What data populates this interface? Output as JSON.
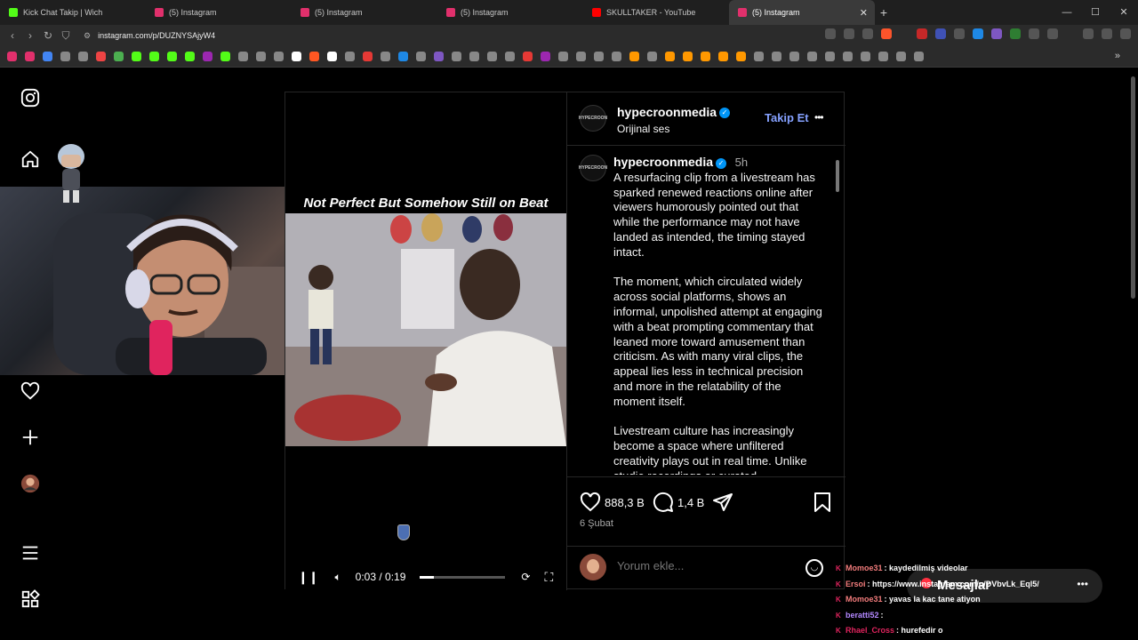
{
  "browser": {
    "tabs": [
      {
        "label": "Kick Chat Takip | Wich",
        "color": "#53fc18",
        "active": false
      },
      {
        "label": "(5) Instagram",
        "color": "#e1306c",
        "active": false
      },
      {
        "label": "(5) Instagram",
        "color": "#e1306c",
        "active": false
      },
      {
        "label": "(5) Instagram",
        "color": "#e1306c",
        "active": false
      },
      {
        "label": "SKULLTAKER - YouTube",
        "color": "#ff0000",
        "active": false
      },
      {
        "label": "(5) Instagram",
        "color": "#e1306c",
        "active": true
      }
    ],
    "new_tab": "+",
    "url": "instagram.com/p/DUZNYSAjyW4",
    "window_controls": [
      "—",
      "☐",
      "✕"
    ]
  },
  "post": {
    "video_title": "Not Perfect But Somehow Still on Beat",
    "time": "0:03 / 0:19",
    "progress": 0.16,
    "author": "hypecroonmedia",
    "avatar_text": "HYPECROON",
    "audio": "Orijinal ses",
    "follow": "Takip Et",
    "more": "•••",
    "caption_time": "5h",
    "caption": [
      "A resurfacing clip from a livestream has sparked renewed reactions online after viewers humorously pointed out that while the performance may not have landed as intended, the timing stayed intact.",
      "The moment, which circulated widely across social platforms, shows an informal, unpolished attempt at engaging with a beat prompting commentary that leaned more toward amusement than criticism. As with many viral clips, the appeal lies less in technical precision and more in the relatability of the moment itself.",
      "Livestream culture has increasingly become a space where unfiltered creativity plays out in real time. Unlike studio recordings or curated"
    ],
    "likes": "888,3 B",
    "comments": "1,4 B",
    "date": "6 Şubat",
    "comment_placeholder": "Yorum ekle..."
  },
  "chat": [
    {
      "user": "Momoe31",
      "text": ": kaydedilmiş videolar",
      "color": "#f27c7c"
    },
    {
      "user": "Ersoi",
      "text": ": https://www.instagram.com/p/DVbvLk_Eql5/",
      "color": "#f27c7c"
    },
    {
      "user": "Momoe31",
      "text": ": yavas la kac tane atiyon",
      "color": "#f27c7c"
    },
    {
      "user": "beratti52",
      "text": ":",
      "color": "#b388ff"
    },
    {
      "user": "Rhael_Cross",
      "text": ": hurefedir o",
      "color": "#e0245e"
    }
  ],
  "messages_label": "Mesajlar",
  "icons": {
    "sidebar": [
      "instagram-icon",
      "home-icon",
      "heart-icon",
      "plus-icon",
      "profile-avatar",
      "menu-icon",
      "more-apps-icon"
    ],
    "like": "heart-icon",
    "comment": "comment-icon",
    "share": "share-icon",
    "save": "bookmark-icon",
    "emoji": "emoji-icon"
  },
  "colors": {
    "accent": "#0095f6",
    "follow": "#85a1ff",
    "border": "#262626"
  }
}
